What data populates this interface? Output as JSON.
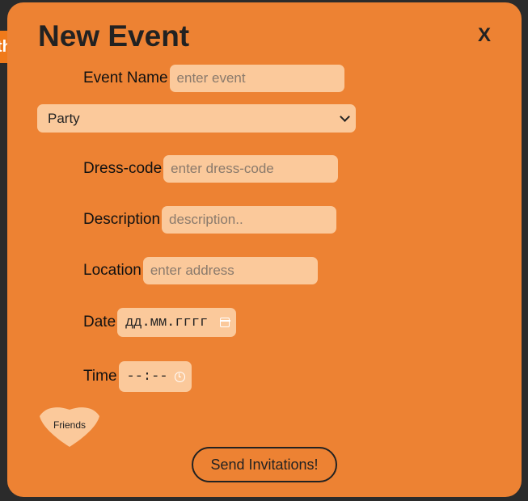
{
  "background": {
    "tab_text": "th"
  },
  "modal": {
    "title": "New Event",
    "close_label": "X",
    "fields": {
      "event_name": {
        "label": "Event Name",
        "placeholder": "enter event"
      },
      "event_type": {
        "selected": "Party"
      },
      "dress_code": {
        "label": "Dress-code",
        "placeholder": "enter dress-code"
      },
      "description": {
        "label": "Description",
        "placeholder": "description.."
      },
      "location": {
        "label": "Location",
        "placeholder": "enter address"
      },
      "date": {
        "label": "Date",
        "placeholder": "дд.мм.гггг"
      },
      "time": {
        "label": "Time",
        "placeholder": "--:--"
      }
    },
    "friends_label": "Friends",
    "send_label": "Send Invitations!"
  },
  "colors": {
    "page_background": "#2b2b2b",
    "modal_background": "#ed8233",
    "input_background": "#fbc99b",
    "text": "#222222"
  }
}
